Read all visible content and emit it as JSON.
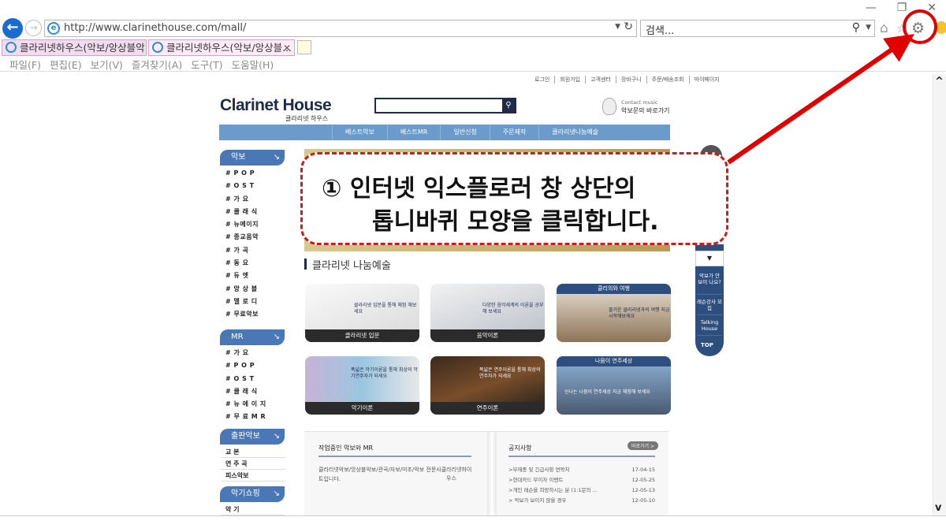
{
  "window": {
    "minimize": "—",
    "restore": "❐",
    "close": "✕"
  },
  "address": {
    "url": "http://www.clarinethouse.com/mall/"
  },
  "search": {
    "placeholder": "검색..."
  },
  "tabs": [
    {
      "label": "클라리넷하우스(악보/앙상블악..."
    },
    {
      "label": "클라리넷하우스(악보/앙상블..."
    }
  ],
  "menu": [
    "파일(F)",
    "편집(E)",
    "보기(V)",
    "즐겨찾기(A)",
    "도구(T)",
    "도움말(H)"
  ],
  "icons": {
    "back": "back-arrow-icon",
    "forward": "forward-arrow-icon",
    "refresh": "refresh-icon",
    "search": "magnifier-icon",
    "home": "home-icon",
    "favorites": "star-icon",
    "tools": "gear-icon",
    "feedback": "smiley-icon"
  },
  "site": {
    "util_links": [
      "로그인",
      "회원가입",
      "고객센터",
      "장바구니",
      "주문/배송조회",
      "마이페이지"
    ],
    "logo": "Clarinet House",
    "logo_sub": "클라리넷 하우스",
    "contact_small": "Contact music",
    "contact_big": "악보문의 바로가기",
    "gnb": [
      "베스트악보",
      "베스트MR",
      "일반신청",
      "주문제작",
      "클라리넷나눔예술"
    ],
    "lnb": {
      "akbo_title": "악보",
      "akbo_items": [
        "# P O P",
        "# O S T",
        "# 가 요",
        "# 클 래 식",
        "# 뉴에이지",
        "# 종교음악",
        "# 가 곡",
        "# 동 요",
        "# 듀 엣",
        "# 앙 상 블",
        "# 멜 로 디",
        "# 무료악보"
      ],
      "mr_title": "MR",
      "mr_items": [
        "# 가 요",
        "# P O P",
        "# O S T",
        "# 클 래 식",
        "# 뉴 에 이 지",
        "# 무 료 M R"
      ],
      "pub_title": "출판악보",
      "pub_items": [
        "교 본",
        "연 주 곡",
        "피스악보"
      ],
      "shop_title": "악기쇼핑",
      "shop_items": [
        "악 기"
      ]
    },
    "quick": {
      "item1": "악보가 안 보이 나요?",
      "item2": "레슨강사 모집",
      "item3": "Talking House",
      "top": "TOP"
    },
    "section_title": "클라리넷 나눔예술",
    "thumbs": [
      {
        "label": "클라리넷 입문",
        "caption": "클라리넷 입문을 통해 체험 해보세요"
      },
      {
        "label": "음악이론",
        "caption": "다양한 음악세계의 이론을 공부해 보세요"
      },
      {
        "label": "클리의와 여행",
        "caption": "즐거운 클라리넷과의 여행 지금 시작해보세요"
      },
      {
        "label": "악기이론",
        "caption": "폭넓은 악기이론을 통해 최상의 악기연주자가 되세요"
      },
      {
        "label": "연주이론",
        "caption": "폭넓은 연주이론을 통해 최상의 연주자가 되세요"
      },
      {
        "label": "나뭄이 연주세상",
        "caption": "신나는 나뭄이 연주세상 지금 체험해 보세요"
      }
    ],
    "panel": {
      "left_title": "작업중인 악보와 MR",
      "left_text": "클라리넷악보/앙상블악보/관곡/자보/미조/악보 전문사클라리넷하이트입니다.",
      "left_text2": "우스",
      "right_title": "공지사항",
      "more": "바로가기 >",
      "notices": [
        {
          "title": ">부재중 및 긴급사항 연락처",
          "date": "17-04-15"
        },
        {
          "title": ">현대카드 무이자 이벤트",
          "date": "12-05-25"
        },
        {
          "title": ">개인 레슨을 희망하시는 분 (1:1문의 ...",
          "date": "12-05-13"
        },
        {
          "title": "> 악보가 보이지 않을 경우",
          "date": "12-05-10"
        }
      ]
    }
  },
  "callout": {
    "line1": "① 인터넷 익스플로러 창 상단의",
    "line2": "톱니바퀴 모양을 클릭합니다.",
    "color": "#c81e1e"
  }
}
